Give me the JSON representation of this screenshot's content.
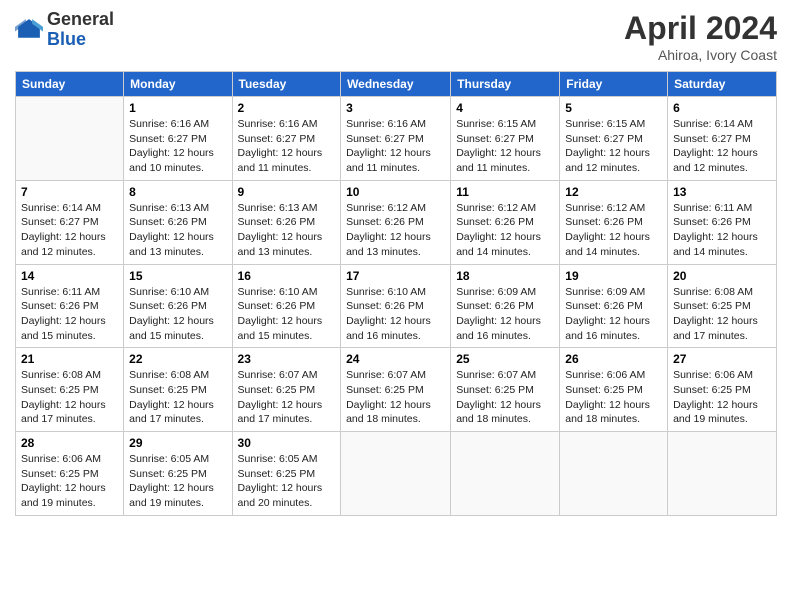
{
  "header": {
    "logo_line1": "General",
    "logo_line2": "Blue",
    "month": "April 2024",
    "location": "Ahiroa, Ivory Coast"
  },
  "columns": [
    "Sunday",
    "Monday",
    "Tuesday",
    "Wednesday",
    "Thursday",
    "Friday",
    "Saturday"
  ],
  "weeks": [
    [
      {
        "day": "",
        "info": ""
      },
      {
        "day": "1",
        "info": "Sunrise: 6:16 AM\nSunset: 6:27 PM\nDaylight: 12 hours\nand 10 minutes."
      },
      {
        "day": "2",
        "info": "Sunrise: 6:16 AM\nSunset: 6:27 PM\nDaylight: 12 hours\nand 11 minutes."
      },
      {
        "day": "3",
        "info": "Sunrise: 6:16 AM\nSunset: 6:27 PM\nDaylight: 12 hours\nand 11 minutes."
      },
      {
        "day": "4",
        "info": "Sunrise: 6:15 AM\nSunset: 6:27 PM\nDaylight: 12 hours\nand 11 minutes."
      },
      {
        "day": "5",
        "info": "Sunrise: 6:15 AM\nSunset: 6:27 PM\nDaylight: 12 hours\nand 12 minutes."
      },
      {
        "day": "6",
        "info": "Sunrise: 6:14 AM\nSunset: 6:27 PM\nDaylight: 12 hours\nand 12 minutes."
      }
    ],
    [
      {
        "day": "7",
        "info": "Sunrise: 6:14 AM\nSunset: 6:27 PM\nDaylight: 12 hours\nand 12 minutes."
      },
      {
        "day": "8",
        "info": "Sunrise: 6:13 AM\nSunset: 6:26 PM\nDaylight: 12 hours\nand 13 minutes."
      },
      {
        "day": "9",
        "info": "Sunrise: 6:13 AM\nSunset: 6:26 PM\nDaylight: 12 hours\nand 13 minutes."
      },
      {
        "day": "10",
        "info": "Sunrise: 6:12 AM\nSunset: 6:26 PM\nDaylight: 12 hours\nand 13 minutes."
      },
      {
        "day": "11",
        "info": "Sunrise: 6:12 AM\nSunset: 6:26 PM\nDaylight: 12 hours\nand 14 minutes."
      },
      {
        "day": "12",
        "info": "Sunrise: 6:12 AM\nSunset: 6:26 PM\nDaylight: 12 hours\nand 14 minutes."
      },
      {
        "day": "13",
        "info": "Sunrise: 6:11 AM\nSunset: 6:26 PM\nDaylight: 12 hours\nand 14 minutes."
      }
    ],
    [
      {
        "day": "14",
        "info": "Sunrise: 6:11 AM\nSunset: 6:26 PM\nDaylight: 12 hours\nand 15 minutes."
      },
      {
        "day": "15",
        "info": "Sunrise: 6:10 AM\nSunset: 6:26 PM\nDaylight: 12 hours\nand 15 minutes."
      },
      {
        "day": "16",
        "info": "Sunrise: 6:10 AM\nSunset: 6:26 PM\nDaylight: 12 hours\nand 15 minutes."
      },
      {
        "day": "17",
        "info": "Sunrise: 6:10 AM\nSunset: 6:26 PM\nDaylight: 12 hours\nand 16 minutes."
      },
      {
        "day": "18",
        "info": "Sunrise: 6:09 AM\nSunset: 6:26 PM\nDaylight: 12 hours\nand 16 minutes."
      },
      {
        "day": "19",
        "info": "Sunrise: 6:09 AM\nSunset: 6:26 PM\nDaylight: 12 hours\nand 16 minutes."
      },
      {
        "day": "20",
        "info": "Sunrise: 6:08 AM\nSunset: 6:25 PM\nDaylight: 12 hours\nand 17 minutes."
      }
    ],
    [
      {
        "day": "21",
        "info": "Sunrise: 6:08 AM\nSunset: 6:25 PM\nDaylight: 12 hours\nand 17 minutes."
      },
      {
        "day": "22",
        "info": "Sunrise: 6:08 AM\nSunset: 6:25 PM\nDaylight: 12 hours\nand 17 minutes."
      },
      {
        "day": "23",
        "info": "Sunrise: 6:07 AM\nSunset: 6:25 PM\nDaylight: 12 hours\nand 17 minutes."
      },
      {
        "day": "24",
        "info": "Sunrise: 6:07 AM\nSunset: 6:25 PM\nDaylight: 12 hours\nand 18 minutes."
      },
      {
        "day": "25",
        "info": "Sunrise: 6:07 AM\nSunset: 6:25 PM\nDaylight: 12 hours\nand 18 minutes."
      },
      {
        "day": "26",
        "info": "Sunrise: 6:06 AM\nSunset: 6:25 PM\nDaylight: 12 hours\nand 18 minutes."
      },
      {
        "day": "27",
        "info": "Sunrise: 6:06 AM\nSunset: 6:25 PM\nDaylight: 12 hours\nand 19 minutes."
      }
    ],
    [
      {
        "day": "28",
        "info": "Sunrise: 6:06 AM\nSunset: 6:25 PM\nDaylight: 12 hours\nand 19 minutes."
      },
      {
        "day": "29",
        "info": "Sunrise: 6:05 AM\nSunset: 6:25 PM\nDaylight: 12 hours\nand 19 minutes."
      },
      {
        "day": "30",
        "info": "Sunrise: 6:05 AM\nSunset: 6:25 PM\nDaylight: 12 hours\nand 20 minutes."
      },
      {
        "day": "",
        "info": ""
      },
      {
        "day": "",
        "info": ""
      },
      {
        "day": "",
        "info": ""
      },
      {
        "day": "",
        "info": ""
      }
    ]
  ]
}
